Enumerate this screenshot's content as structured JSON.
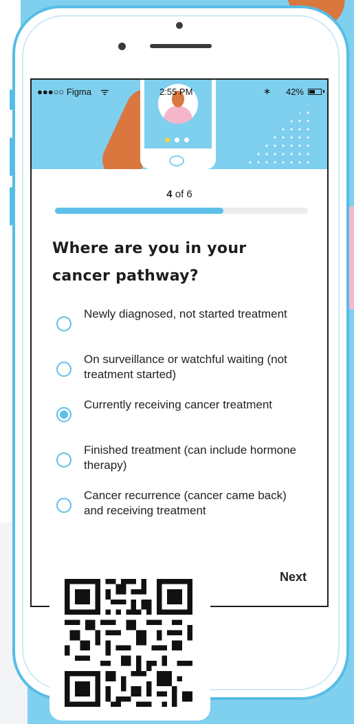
{
  "status_bar": {
    "carrier": "●●●○○ Figma",
    "time": "2:55 PM",
    "battery": "42%"
  },
  "progress": {
    "current": "4",
    "of_text": "of 6",
    "fraction": 0.667
  },
  "question": "Where are you in your cancer pathway?",
  "options": [
    {
      "label": "Newly diagnosed, not started treatment",
      "selected": false
    },
    {
      "label": "On surveillance or watchful waiting (not treatment started)",
      "selected": false
    },
    {
      "label": "Currently receiving cancer treatment",
      "selected": true
    },
    {
      "label": "Finished treatment (can include hormone therapy)",
      "selected": false
    },
    {
      "label": "Cancer recurrence (cancer came back) and receiving treatment",
      "selected": false
    }
  ],
  "next_label": "Next",
  "colors": {
    "accent": "#5ec0e8",
    "frame": "#56bde6",
    "background": "#7fcfee"
  }
}
